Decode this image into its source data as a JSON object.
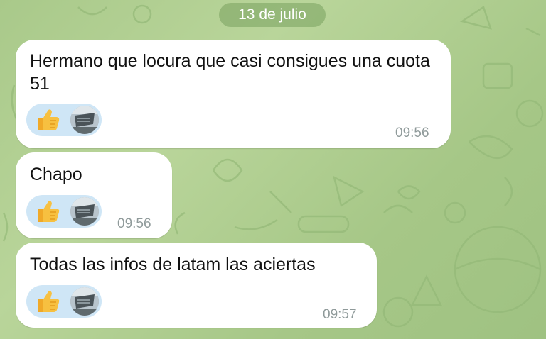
{
  "date_separator": "13 de julio",
  "messages": [
    {
      "text": "Hermano que locura que casi consigues una cuota 51",
      "time": "09:56",
      "reaction": {
        "emoji_icon": "thumbs-up-icon"
      }
    },
    {
      "text": "Chapo",
      "time": "09:56",
      "reaction": {
        "emoji_icon": "thumbs-up-icon"
      }
    },
    {
      "text": "Todas las infos de latam las aciertas",
      "time": "09:57",
      "reaction": {
        "emoji_icon": "thumbs-up-icon"
      }
    }
  ],
  "colors": {
    "wallpaper": "#a9c98a",
    "bubble": "#ffffff",
    "reaction_pill": "#cfe6f6",
    "timestamp": "#8f9a9a",
    "thumbs_up": "#f5b532"
  }
}
